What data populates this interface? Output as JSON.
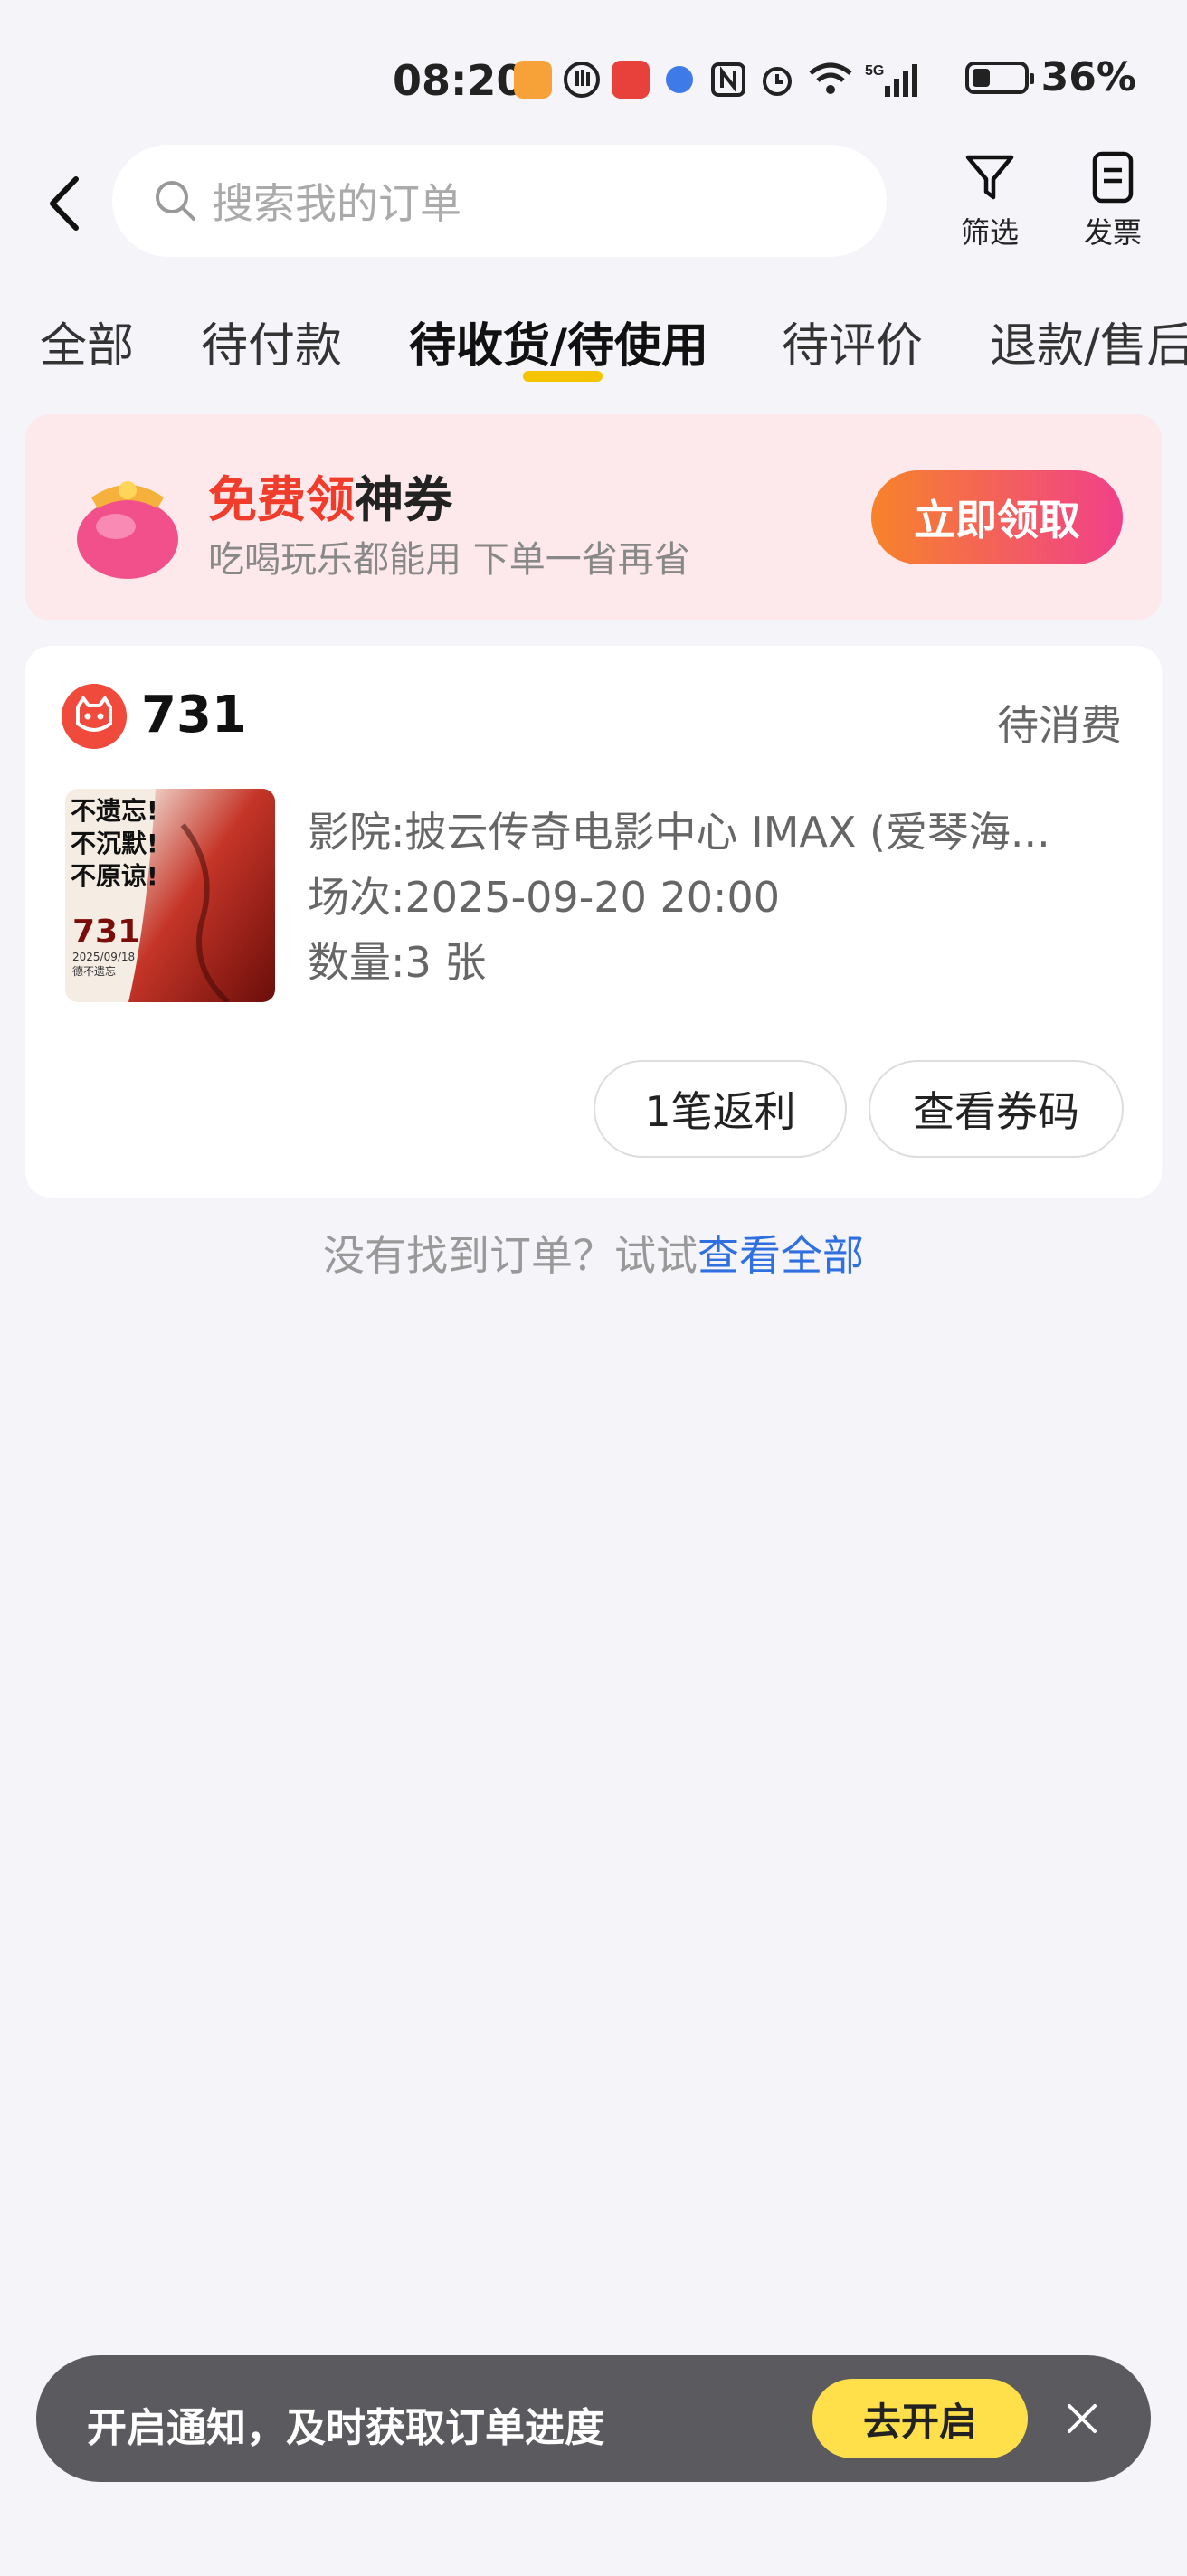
{
  "status_bar": {
    "time": "08:20",
    "battery": "36%",
    "battery_level": 0.36
  },
  "search": {
    "placeholder": "搜索我的订单"
  },
  "tools": {
    "filter": "筛选",
    "invoice": "发票"
  },
  "tabs": [
    "全部",
    "待付款",
    "待收货/待使用",
    "待评价",
    "退款/售后"
  ],
  "active_tab": 2,
  "coupon": {
    "title_red": "免费领",
    "title_black": "神券",
    "subtitle": "吃喝玩乐都能用 下单一省再省",
    "button": "立即领取"
  },
  "order": {
    "shop": "731",
    "status": "待消费",
    "poster": {
      "lines": [
        "不遗忘!",
        "不沉默!",
        "不原谅!"
      ],
      "title": "731",
      "date": "2025/09/18",
      "note": "德不遗忘"
    },
    "cinema_label": "影院:",
    "cinema_value": "披云传奇电影中心 IMAX (爱琴海...",
    "session_label": "场次:",
    "session_value": "2025-09-20 20:00",
    "qty_label": "数量:",
    "qty_value": "3 张",
    "btn_rebate": "1笔返利",
    "btn_code": "查看券码"
  },
  "empty_hint": {
    "text": "没有找到订单？试试",
    "link": "查看全部"
  },
  "notify": {
    "text": "开启通知，及时获取订单进度",
    "button": "去开启"
  },
  "colors": {
    "accent_yellow": "#f5c400",
    "link_blue": "#2f6fe0",
    "coupon_bg": "#fde8ec"
  }
}
